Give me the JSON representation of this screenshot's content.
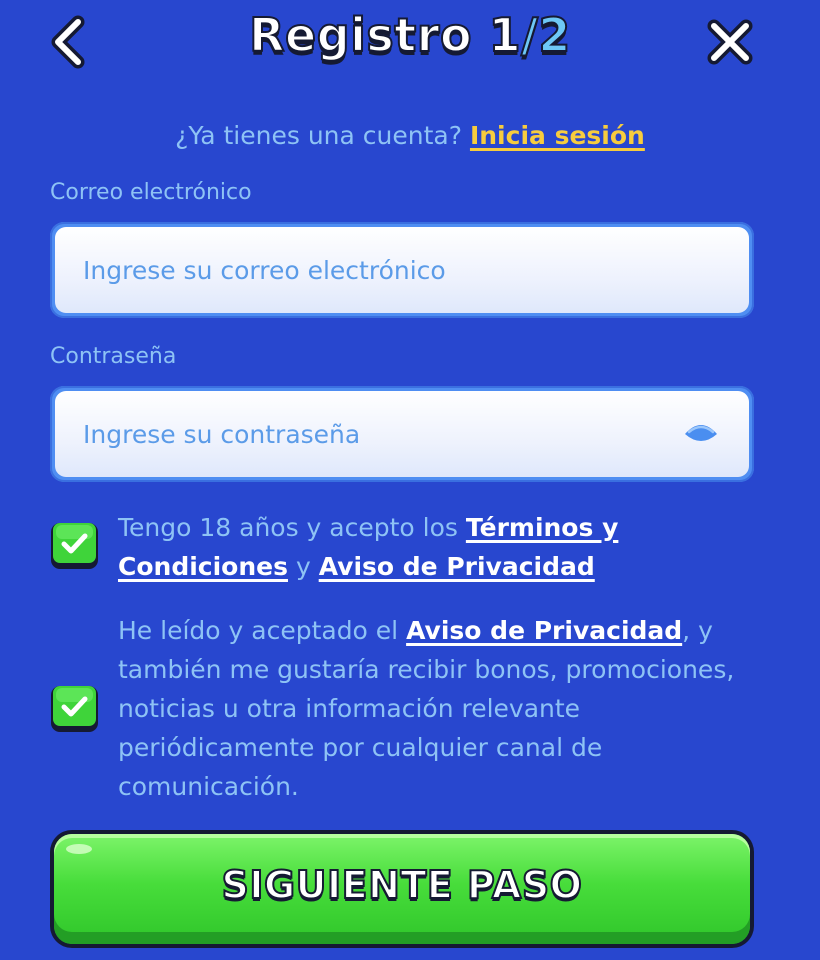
{
  "header": {
    "title_main": "Registro 1",
    "title_slash": "/",
    "title_total": "2"
  },
  "login": {
    "prompt": "¿Ya tienes una cuenta?",
    "link": "Inicia sesión"
  },
  "email": {
    "label": "Correo electrónico",
    "placeholder": "Ingrese su correo electrónico",
    "value": ""
  },
  "password": {
    "label": "Contraseña",
    "placeholder": "Ingrese su contraseña",
    "value": ""
  },
  "terms": {
    "checked": true,
    "text_before": "Tengo 18 años y acepto los",
    "link_terms": "Términos y Condiciones",
    "joiner": "y",
    "link_privacy": "Aviso de Privacidad"
  },
  "marketing": {
    "checked": true,
    "text_before": "He leído y aceptado el",
    "link_privacy": "Aviso de Privacidad",
    "text_after": ", y también me gustaría recibir bonos, promociones, noticias u otra información relevante periódicamente por cualquier canal de comunicación."
  },
  "next_button": {
    "label": "SIGUIENTE PASO"
  },
  "icons": {
    "back": "chevron-left-icon",
    "close": "close-icon",
    "eye": "eye-icon",
    "check": "checkmark-icon"
  },
  "colors": {
    "background": "#2847cf",
    "text_muted": "#8ec3f5",
    "link_yellow": "#f7cc3e",
    "button_green": "#48dd3b",
    "checkbox_green": "#3fd43a",
    "outline_dark": "#151a33"
  }
}
